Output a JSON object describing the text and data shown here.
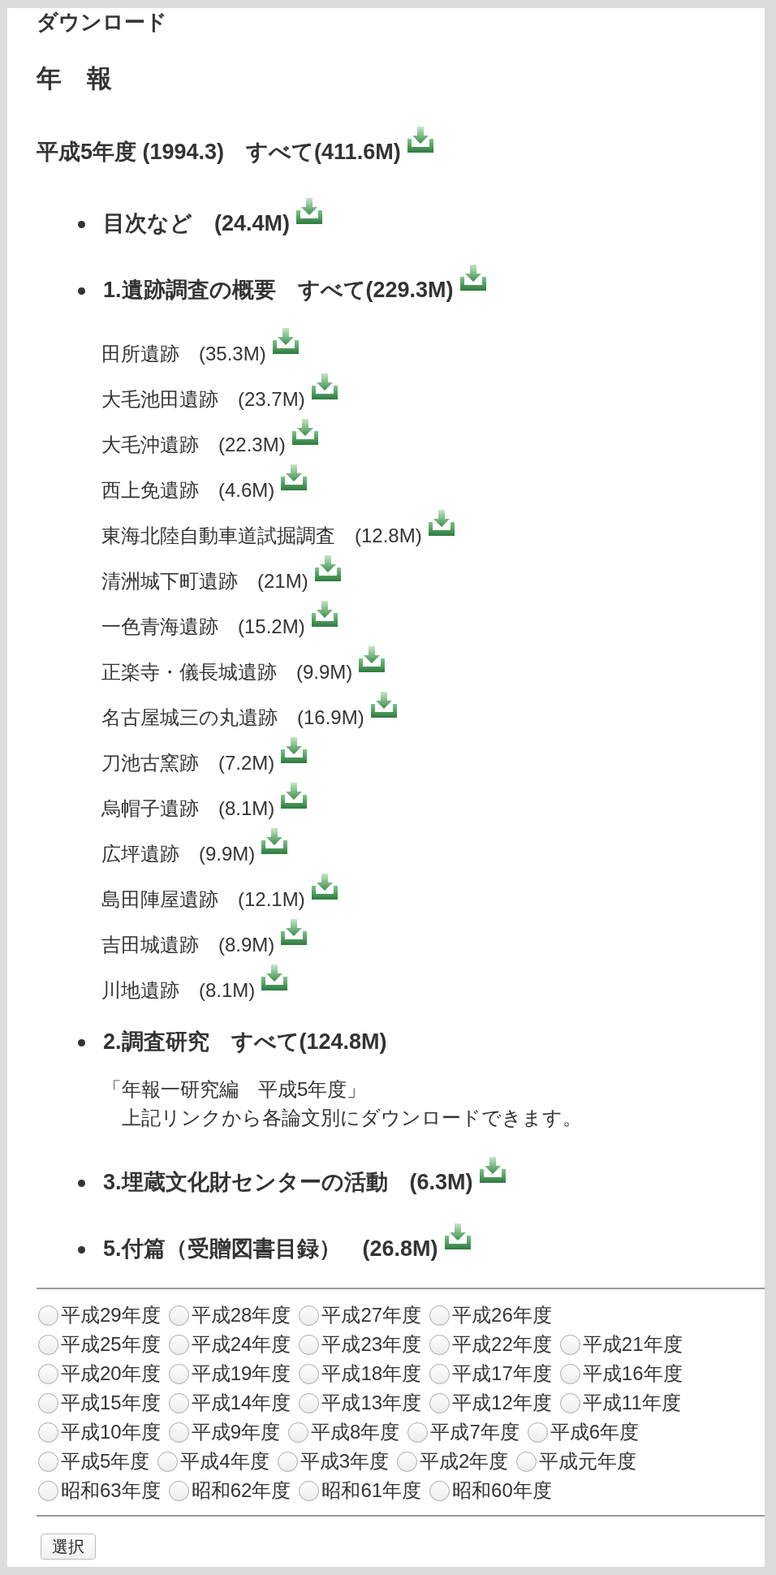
{
  "page": {
    "title": "ダウンロード",
    "section_title": "年　報"
  },
  "year_header": {
    "label": "平成5年度 (1994.3)　すべて(411.6M)",
    "downloadable": true
  },
  "items": [
    {
      "label": "目次など　(24.4M)",
      "downloadable": true
    },
    {
      "label": "1.遺跡調査の概要　すべて(229.3M)",
      "downloadable": true,
      "children": [
        {
          "label": "田所遺跡　(35.3M)",
          "downloadable": true
        },
        {
          "label": "大毛池田遺跡　(23.7M)",
          "downloadable": true
        },
        {
          "label": "大毛沖遺跡　(22.3M)",
          "downloadable": true
        },
        {
          "label": "西上免遺跡　(4.6M)",
          "downloadable": true
        },
        {
          "label": "東海北陸自動車道試掘調査　(12.8M)",
          "downloadable": true
        },
        {
          "label": "清洲城下町遺跡　(21M)",
          "downloadable": true
        },
        {
          "label": "一色青海遺跡　(15.2M)",
          "downloadable": true
        },
        {
          "label": "正楽寺・儀長城遺跡　(9.9M)",
          "downloadable": true
        },
        {
          "label": "名古屋城三の丸遺跡　(16.9M)",
          "downloadable": true
        },
        {
          "label": "刀池古窯跡　(7.2M)",
          "downloadable": true
        },
        {
          "label": "烏帽子遺跡　(8.1M)",
          "downloadable": true
        },
        {
          "label": "広坪遺跡　(9.9M)",
          "downloadable": true
        },
        {
          "label": "島田陣屋遺跡　(12.1M)",
          "downloadable": true
        },
        {
          "label": "吉田城遺跡　(8.9M)",
          "downloadable": true
        },
        {
          "label": "川地遺跡　(8.1M)",
          "downloadable": true
        }
      ]
    },
    {
      "label": "2.調査研究　すべて(124.8M)",
      "downloadable": false,
      "notes": [
        {
          "kind": "reference",
          "text": "「年報一研究編　平成5年度」"
        },
        {
          "kind": "instruction",
          "text": "上記リンクから各論文別にダウンロードできます。"
        }
      ]
    },
    {
      "label": "3.埋蔵文化財センターの活動　(6.3M)",
      "downloadable": true
    },
    {
      "label": "5.付篇（受贈図書目録）　(26.8M)",
      "downloadable": true
    }
  ],
  "year_selector": {
    "rows": [
      {
        "options": [
          {
            "label": "平成29年度",
            "selected": false
          },
          {
            "label": "平成28年度",
            "selected": false
          },
          {
            "label": "平成27年度",
            "selected": false
          },
          {
            "label": "平成26年度",
            "selected": false
          }
        ]
      },
      {
        "options": [
          {
            "label": "平成25年度",
            "selected": false
          },
          {
            "label": "平成24年度",
            "selected": false
          },
          {
            "label": "平成23年度",
            "selected": false
          },
          {
            "label": "平成22年度",
            "selected": false
          },
          {
            "label": "平成21年度",
            "selected": false
          }
        ]
      },
      {
        "options": [
          {
            "label": "平成20年度",
            "selected": false
          },
          {
            "label": "平成19年度",
            "selected": false
          },
          {
            "label": "平成18年度",
            "selected": false
          },
          {
            "label": "平成17年度",
            "selected": false
          },
          {
            "label": "平成16年度",
            "selected": false
          }
        ]
      },
      {
        "options": [
          {
            "label": "平成15年度",
            "selected": false
          },
          {
            "label": "平成14年度",
            "selected": false
          },
          {
            "label": "平成13年度",
            "selected": false
          },
          {
            "label": "平成12年度",
            "selected": false
          },
          {
            "label": "平成11年度",
            "selected": false
          }
        ]
      },
      {
        "options": [
          {
            "label": "平成10年度",
            "selected": false
          },
          {
            "label": "平成9年度",
            "selected": false
          },
          {
            "label": "平成8年度",
            "selected": false
          },
          {
            "label": "平成7年度",
            "selected": false
          },
          {
            "label": "平成6年度",
            "selected": false
          }
        ]
      },
      {
        "options": [
          {
            "label": "平成5年度",
            "selected": false
          },
          {
            "label": "平成4年度",
            "selected": false
          },
          {
            "label": "平成3年度",
            "selected": false
          },
          {
            "label": "平成2年度",
            "selected": false
          },
          {
            "label": "平成元年度",
            "selected": false
          }
        ]
      },
      {
        "options": [
          {
            "label": "昭和63年度",
            "selected": false
          },
          {
            "label": "昭和62年度",
            "selected": false
          },
          {
            "label": "昭和61年度",
            "selected": false
          },
          {
            "label": "昭和60年度",
            "selected": false
          }
        ]
      }
    ],
    "button": "選択"
  }
}
